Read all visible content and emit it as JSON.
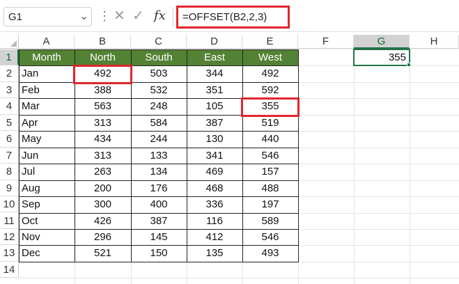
{
  "name_box": {
    "value": "G1",
    "dropdown_icon": "chevron-down-icon"
  },
  "formula_bar": {
    "more_icon": "vertical-dots-icon",
    "cancel_icon": "cross-icon",
    "enter_icon": "check-icon",
    "fx_label": "fx",
    "formula": "=OFFSET(B2,2,3)"
  },
  "columns": [
    "A",
    "B",
    "C",
    "D",
    "E",
    "F",
    "G",
    "H"
  ],
  "selected_column": "G",
  "rows": [
    "1",
    "2",
    "3",
    "4",
    "5",
    "6",
    "7",
    "8",
    "9",
    "10",
    "11",
    "12",
    "13",
    "14"
  ],
  "selected_row": "1",
  "table": {
    "headers": [
      "Month",
      "North",
      "South",
      "East",
      "West"
    ],
    "header_color": "#548235",
    "rows": [
      [
        "Jan",
        "492",
        "503",
        "344",
        "492"
      ],
      [
        "Feb",
        "388",
        "532",
        "351",
        "592"
      ],
      [
        "Mar",
        "563",
        "248",
        "105",
        "355"
      ],
      [
        "Apr",
        "313",
        "584",
        "387",
        "519"
      ],
      [
        "May",
        "434",
        "244",
        "130",
        "440"
      ],
      [
        "Jun",
        "313",
        "133",
        "341",
        "546"
      ],
      [
        "Jul",
        "263",
        "134",
        "469",
        "157"
      ],
      [
        "Aug",
        "200",
        "176",
        "468",
        "488"
      ],
      [
        "Sep",
        "300",
        "400",
        "336",
        "197"
      ],
      [
        "Oct",
        "426",
        "387",
        "116",
        "589"
      ],
      [
        "Nov",
        "296",
        "145",
        "412",
        "546"
      ],
      [
        "Dec",
        "521",
        "150",
        "135",
        "493"
      ]
    ]
  },
  "result_cell": {
    "ref": "G1",
    "value": "355"
  },
  "highlight_color": "#e0252d",
  "selection_color": "#217346"
}
